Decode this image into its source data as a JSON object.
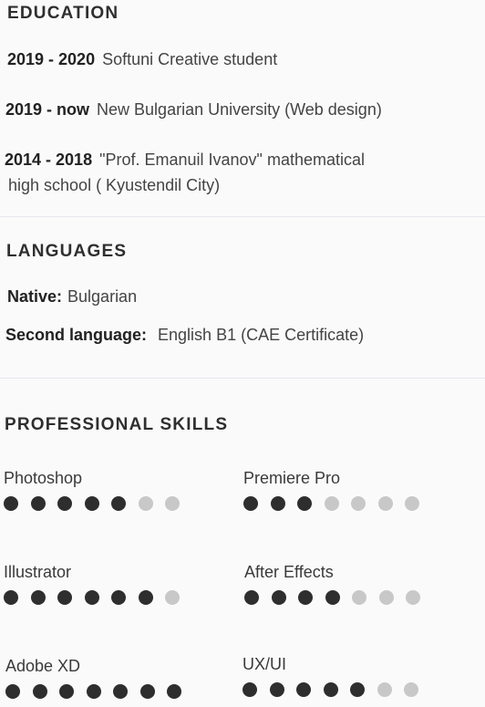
{
  "education": {
    "heading": "EDUCATION",
    "items": [
      {
        "years": "2019 - 2020",
        "text": "Softuni Creative student",
        "text2": ""
      },
      {
        "years": "2019 - now",
        "text": "New Bulgarian University (Web design)",
        "text2": ""
      },
      {
        "years": "2014 - 2018",
        "text": "\"Prof. Emanuil Ivanov\" mathematical",
        "text2": "high school ( Kyustendil City)"
      }
    ]
  },
  "languages": {
    "heading": "LANGUAGES",
    "native_label": "Native:",
    "native_value": "Bulgarian",
    "second_label": "Second language:",
    "second_value": "English B1 (CAE Certificate)"
  },
  "skills": {
    "heading": "PROFESSIONAL SKILLS",
    "scale_max": 7,
    "items": [
      {
        "name": "Photoshop",
        "level": 5
      },
      {
        "name": "Premiere Pro",
        "level": 3
      },
      {
        "name": "Illustrator",
        "level": 6
      },
      {
        "name": "After Effects",
        "level": 4
      },
      {
        "name": "Adobe XD",
        "level": 7
      },
      {
        "name": "UX/UI",
        "level": 5
      }
    ]
  },
  "colors": {
    "dot_on": "#2e2e2e",
    "dot_off": "#c8c8c8"
  }
}
